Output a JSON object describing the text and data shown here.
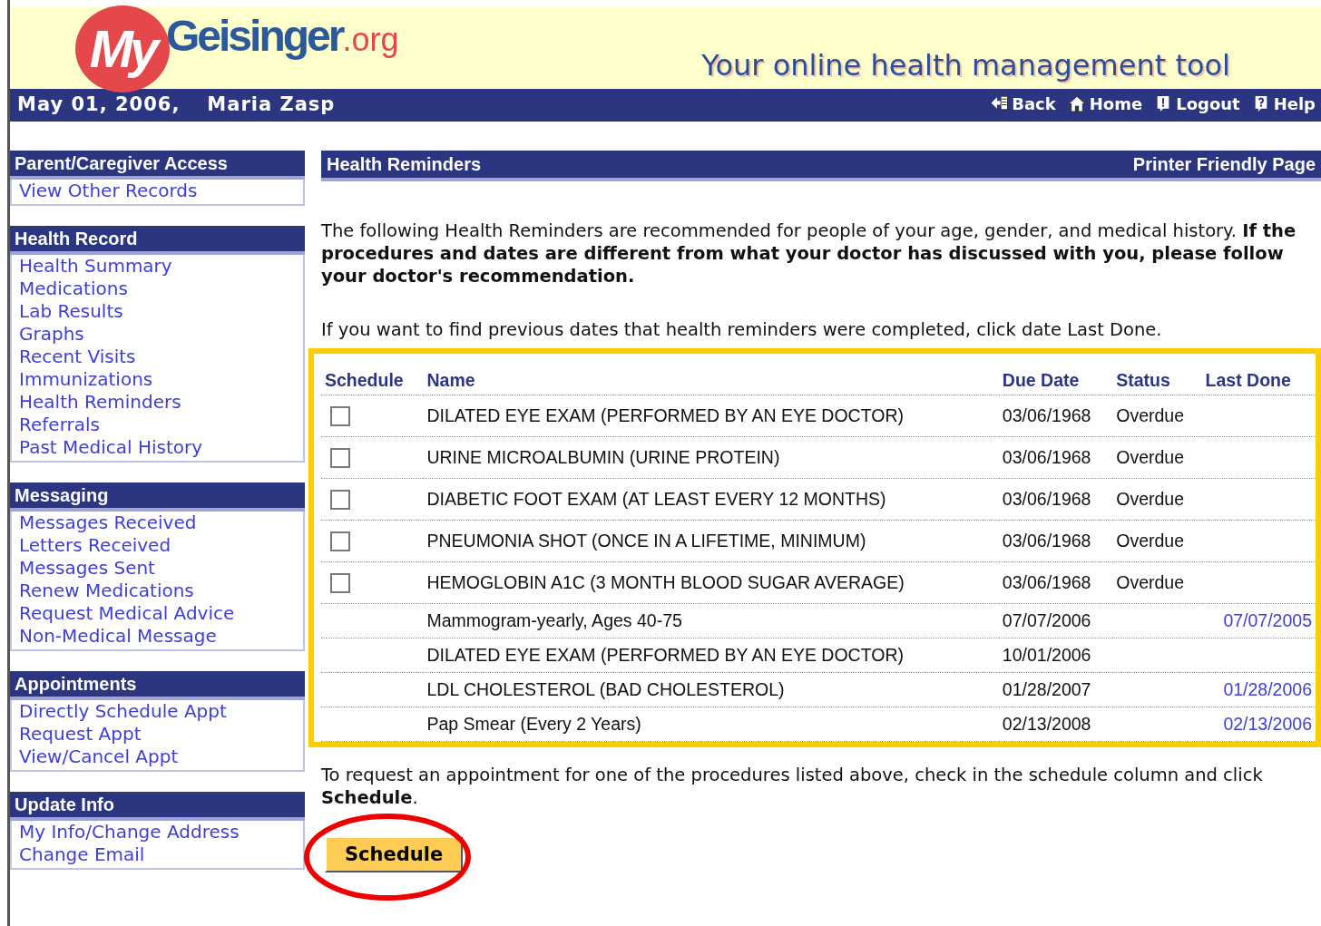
{
  "header": {
    "logo": {
      "my": "My",
      "name": "Geisinger",
      "suffix": ".org"
    },
    "tagline": "Your online health management tool",
    "date": "May 01, 2006,",
    "user": "Maria Zasp",
    "nav": [
      {
        "kind": "back",
        "label": "Back"
      },
      {
        "kind": "home",
        "label": "Home"
      },
      {
        "kind": "logout",
        "label": "Logout"
      },
      {
        "kind": "help",
        "label": "Help"
      }
    ]
  },
  "sidebar": [
    {
      "title": "Parent/Caregiver Access",
      "items": [
        "View Other Records"
      ]
    },
    {
      "title": "Health Record",
      "items": [
        "Health Summary",
        "Medications",
        "Lab Results",
        "Graphs",
        "Recent Visits",
        "Immunizations",
        "Health Reminders",
        "Referrals",
        "Past Medical History"
      ]
    },
    {
      "title": "Messaging",
      "items": [
        "Messages Received",
        "Letters Received",
        "Messages Sent",
        "Renew Medications",
        "Request Medical Advice",
        "Non-Medical Message"
      ]
    },
    {
      "title": "Appointments",
      "items": [
        "Directly Schedule Appt",
        "Request Appt",
        "View/Cancel Appt"
      ]
    },
    {
      "title": "Update Info",
      "items": [
        "My Info/Change Address",
        "Change Email"
      ]
    }
  ],
  "main": {
    "title": "Health Reminders",
    "printer_link": "Printer Friendly Page",
    "intro": "The following Health Reminders are recommended for people of your age, gender, and medical history. **If the procedures and dates are different from what your doctor has discussed with you, please follow your doctor's recommendation.**",
    "hint": "If you want to find previous dates that health reminders were completed, click date Last Done.",
    "table": {
      "highlighted": true,
      "columns": [
        "Schedule",
        "Name",
        "Due Date",
        "Status",
        "Last Done"
      ],
      "rows": [
        {
          "schedulable": true,
          "checked": false,
          "name": "DILATED EYE EXAM (PERFORMED BY AN EYE DOCTOR)",
          "due": "03/06/1968",
          "status": "Overdue"
        },
        {
          "schedulable": true,
          "checked": false,
          "name": "URINE MICROALBUMIN (URINE PROTEIN)",
          "due": "03/06/1968",
          "status": "Overdue"
        },
        {
          "schedulable": true,
          "checked": false,
          "name": "DIABETIC FOOT EXAM (AT LEAST EVERY 12 MONTHS)",
          "due": "03/06/1968",
          "status": "Overdue"
        },
        {
          "schedulable": true,
          "checked": false,
          "name": "PNEUMONIA SHOT (ONCE IN A LIFETIME, MINIMUM)",
          "due": "03/06/1968",
          "status": "Overdue"
        },
        {
          "schedulable": true,
          "checked": false,
          "name": "HEMOGLOBIN A1C (3 MONTH BLOOD SUGAR AVERAGE)",
          "due": "03/06/1968",
          "status": "Overdue"
        },
        {
          "schedulable": false,
          "name": "Mammogram-yearly, Ages 40-75",
          "due": "07/07/2006",
          "last_done": "07/07/2005"
        },
        {
          "schedulable": false,
          "name": "DILATED EYE EXAM (PERFORMED BY AN EYE DOCTOR)",
          "due": "10/01/2006"
        },
        {
          "schedulable": false,
          "name": "LDL CHOLESTEROL (BAD CHOLESTEROL)",
          "due": "01/28/2007",
          "last_done": "01/28/2006"
        },
        {
          "schedulable": false,
          "name": "Pap Smear (Every 2 Years)",
          "due": "02/13/2008",
          "last_done": "02/13/2006"
        }
      ]
    },
    "footer_text": "To request an appointment for one of the procedures listed above, check in the schedule column and click **Schedule**.",
    "button": {
      "label": "Schedule",
      "circled": true
    }
  }
}
